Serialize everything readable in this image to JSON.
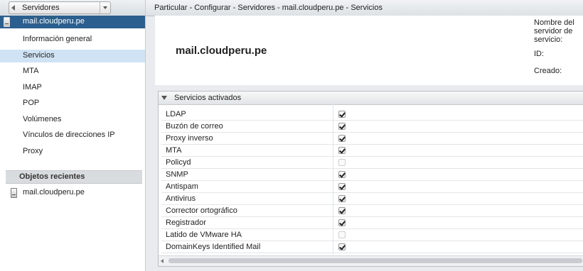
{
  "sidebar": {
    "back_label": "Servidores",
    "host_label": "mail.cloudperu.pe",
    "items": [
      {
        "label": "Información general"
      },
      {
        "label": "Servicios"
      },
      {
        "label": "MTA"
      },
      {
        "label": "IMAP"
      },
      {
        "label": "POP"
      },
      {
        "label": "Volúmenes"
      },
      {
        "label": "Vínculos de direcciones IP"
      },
      {
        "label": "Proxy"
      }
    ],
    "active_item": "Servicios",
    "recent_header": "Objetos recientes",
    "recent_items": [
      {
        "label": "mail.cloudperu.pe"
      }
    ]
  },
  "main": {
    "breadcrumb": "Particular - Configurar - Servidores - mail.cloudperu.pe - Servicios",
    "title": "mail.cloudperu.pe",
    "props": {
      "server_name_label": "Nombre del servidor de servicio:",
      "id_label": "ID:",
      "created_label": "Creado:"
    },
    "services_section": "Servicios activados",
    "services": [
      {
        "name": "LDAP",
        "checked": true
      },
      {
        "name": "Buzón de correo",
        "checked": true
      },
      {
        "name": "Proxy inverso",
        "checked": true
      },
      {
        "name": "MTA",
        "checked": true
      },
      {
        "name": "Policyd",
        "checked": false
      },
      {
        "name": "SNMP",
        "checked": true
      },
      {
        "name": "Antispam",
        "checked": true
      },
      {
        "name": "Antivirus",
        "checked": true
      },
      {
        "name": "Corrector ortográfico",
        "checked": true
      },
      {
        "name": "Registrador",
        "checked": true
      },
      {
        "name": "Latido de VMware HA",
        "checked": false
      },
      {
        "name": "DomainKeys Identified Mail",
        "checked": true
      }
    ]
  },
  "colors": {
    "selection": "#2b5f8f",
    "active_item": "#cfe3f5"
  }
}
